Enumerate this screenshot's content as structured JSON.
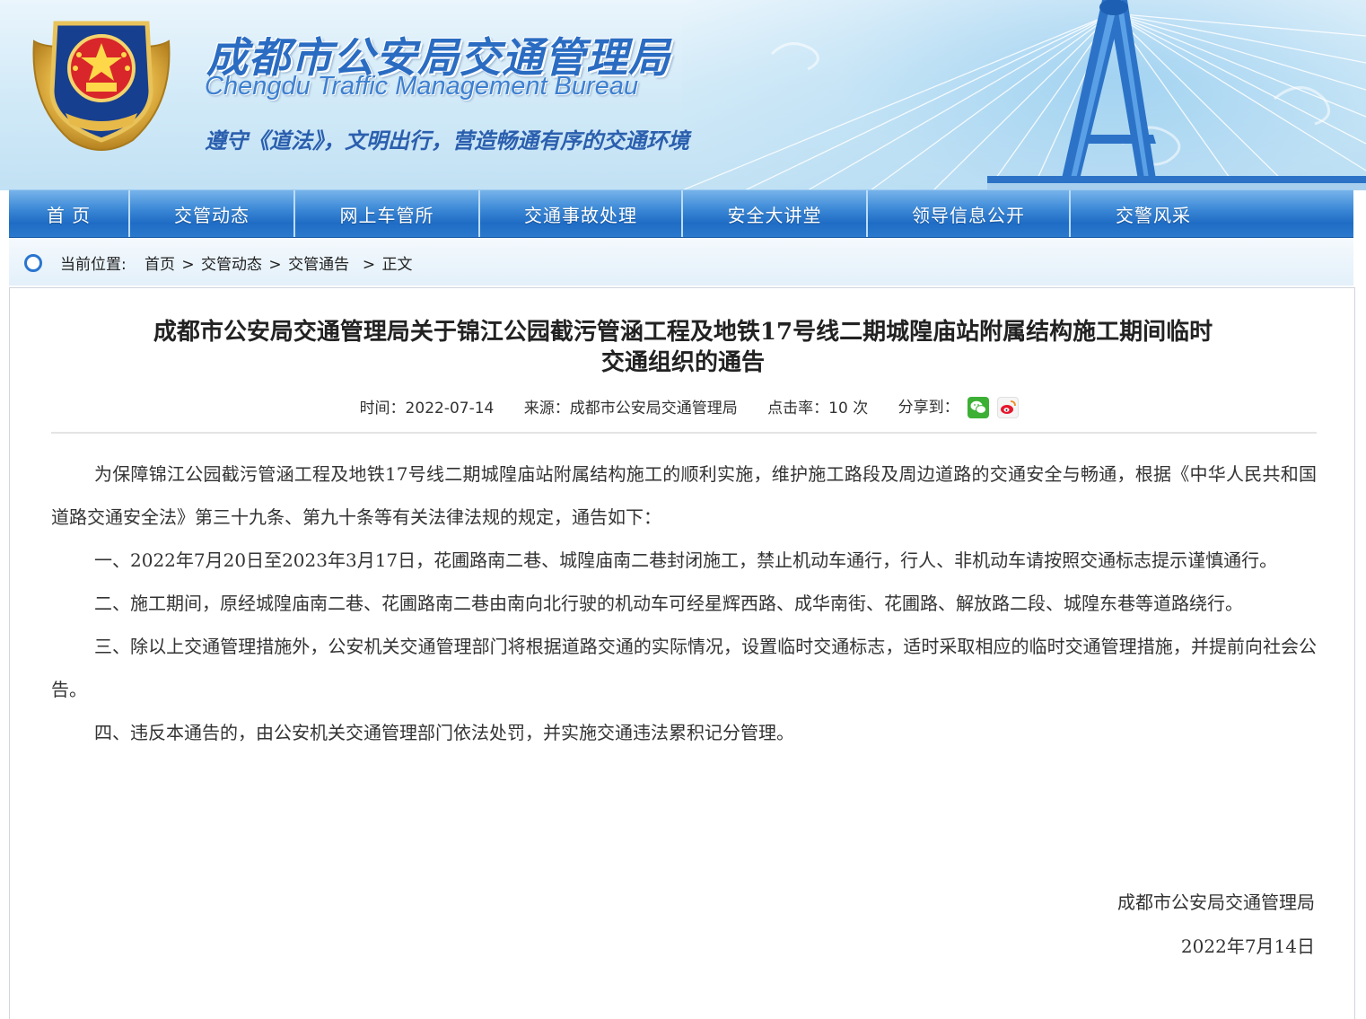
{
  "header": {
    "title_cn": "成都市公安局交通管理局",
    "title_en": "Chengdu Traffic Management Bureau",
    "slogan": "遵守《道法》，文明出行，营造畅通有序的交通环境"
  },
  "nav": {
    "items": [
      {
        "label": "首 页"
      },
      {
        "label": "交管动态"
      },
      {
        "label": "网上车管所"
      },
      {
        "label": "交通事故处理"
      },
      {
        "label": "安全大讲堂"
      },
      {
        "label": "领导信息公开"
      },
      {
        "label": "交警风采"
      }
    ]
  },
  "breadcrumb": {
    "label": "当前位置:",
    "items": [
      "首页",
      "交管动态",
      "交管通告",
      "正文"
    ],
    "separator": ">"
  },
  "article": {
    "title_line1": "成都市公安局交通管理局关于锦江公园截污管涵工程及地铁17号线二期城隍庙站附属结构施工期间临时",
    "title_line2": "交通组织的通告",
    "meta": {
      "time": "时间：2022-07-14",
      "source": "来源：成都市公安局交通管理局",
      "clicks": "点击率：10 次",
      "share": "分享到："
    },
    "paragraphs": [
      "为保障锦江公园截污管涵工程及地铁17号线二期城隍庙站附属结构施工的顺利实施，维护施工路段及周边道路的交通安全与畅通，根据《中华人民共和国道路交通安全法》第三十九条、第九十条等有关法律法规的规定，通告如下：",
      "一、2022年7月20日至2023年3月17日，花圃路南二巷、城隍庙南二巷封闭施工，禁止机动车通行，行人、非机动车请按照交通标志提示谨慎通行。",
      "二、施工期间，原经城隍庙南二巷、花圃路南二巷由南向北行驶的机动车可经星辉西路、成华南街、花圃路、解放路二段、城隍东巷等道路绕行。",
      "三、除以上交通管理措施外，公安机关交通管理部门将根据道路交通的实际情况，设置临时交通标志，适时采取相应的临时交通管理措施，并提前向社会公告。",
      "四、违反本通告的，由公安机关交通管理部门依法处罚，并实施交通违法累积记分管理。"
    ],
    "signature": "成都市公安局交通管理局",
    "date": "2022年7月14日"
  },
  "icons": {
    "breadcrumb": "location-circle-icon",
    "share": [
      "wechat-icon",
      "weibo-icon"
    ]
  },
  "colors": {
    "nav": "#2b79cd",
    "accent": "#2a6cc2"
  }
}
